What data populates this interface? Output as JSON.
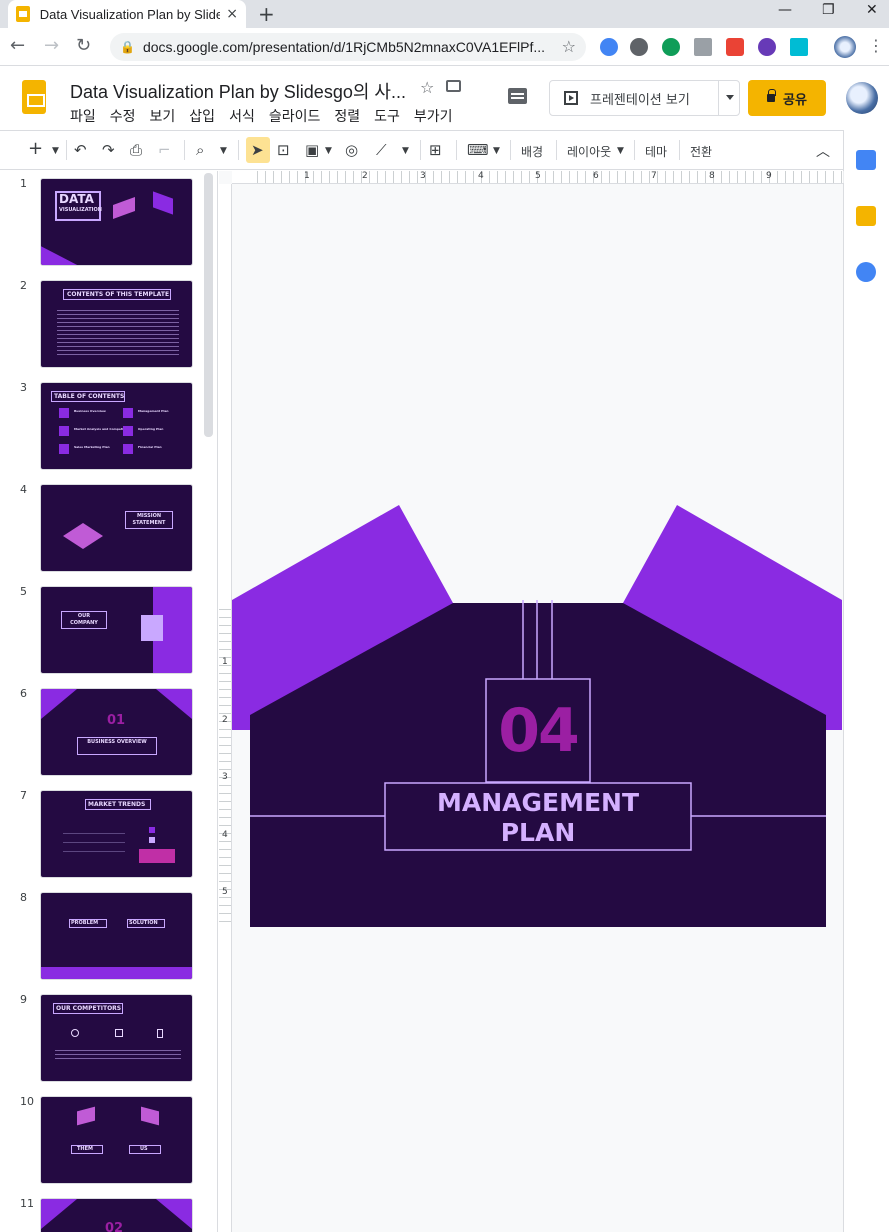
{
  "browser": {
    "tab_title": "Data Visualization Plan by Slide",
    "tab_close": "×",
    "new_tab": "+",
    "url": "docs.google.com/presentation/d/1RjCMb5N2mnaxC0VA1EFlPf...",
    "window_controls": [
      "—",
      "❐",
      "✕"
    ],
    "nav": {
      "back": "←",
      "forward": "→",
      "reload": "↻"
    }
  },
  "docs": {
    "title": "Data Visualization Plan by Slidesgo의 사...",
    "menu": [
      "파일",
      "수정",
      "보기",
      "삽입",
      "서식",
      "슬라이드",
      "정렬",
      "도구",
      "부가기"
    ],
    "present_label": "프레젠테이션 보기",
    "share_label": "공유"
  },
  "toolbar": {
    "background": "배경",
    "layout": "레이아웃",
    "theme": "테마",
    "transition": "전환"
  },
  "ruler": {
    "top": [
      "1",
      "2",
      "3",
      "4",
      "5",
      "6",
      "7",
      "8",
      "9"
    ],
    "left": [
      "1",
      "2",
      "3",
      "4",
      "5"
    ]
  },
  "slides": [
    {
      "num": "1",
      "title": "DATA",
      "subtitle": "VISUALIZATION"
    },
    {
      "num": "2",
      "title": "CONTENTS OF THIS TEMPLATE"
    },
    {
      "num": "3",
      "title": "TABLE OF CONTENTS",
      "items": [
        "Business Overview",
        "Market Analysis and Competition",
        "Sales Marketing Plan",
        "Management Plan",
        "Operating Plan",
        "Financial Plan"
      ]
    },
    {
      "num": "4",
      "title": "MISSION STATEMENT"
    },
    {
      "num": "5",
      "title": "OUR COMPANY"
    },
    {
      "num": "6",
      "title": "BUSINESS OVERVIEW",
      "number": "01"
    },
    {
      "num": "7",
      "title": "MARKET TRENDS"
    },
    {
      "num": "8",
      "title": "PROBLEM",
      "title2": "SOLUTION"
    },
    {
      "num": "9",
      "title": "OUR COMPETITORS"
    },
    {
      "num": "10",
      "title": "THEM",
      "title2": "US"
    },
    {
      "num": "11",
      "number": "02"
    }
  ],
  "current_slide": {
    "number": "04",
    "title_line1": "MANAGEMENT",
    "title_line2": "PLAN"
  },
  "colors": {
    "slide_bg": "#240a42",
    "accent_purple": "#8a2be2",
    "number_magenta": "#9b1fa3",
    "title_lavender": "#d4b0ff",
    "line_lavender": "#c9a8ff",
    "share_yellow": "#f4b400"
  }
}
